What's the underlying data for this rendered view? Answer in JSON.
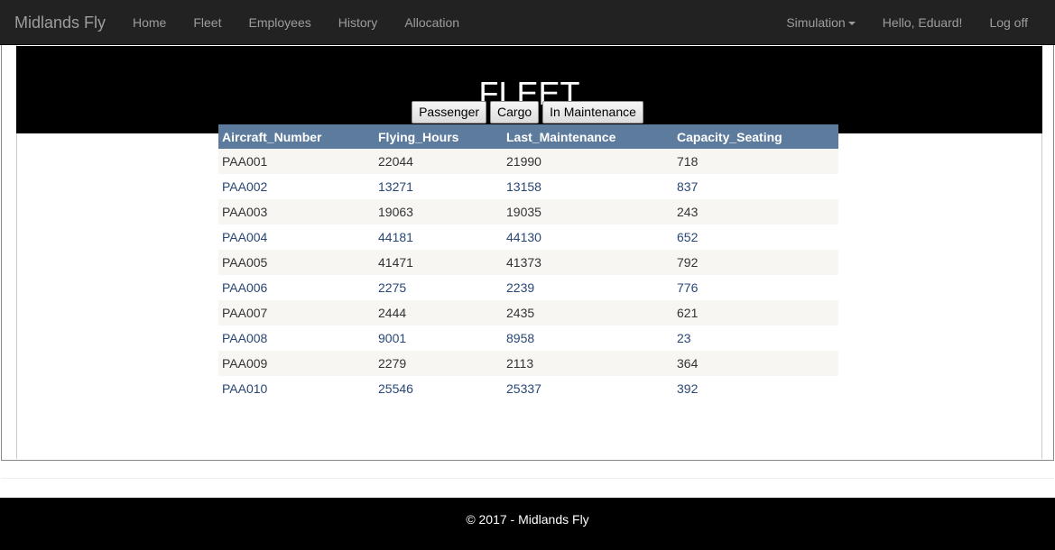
{
  "navbar": {
    "brand": "Midlands Fly",
    "left_items": [
      "Home",
      "Fleet",
      "Employees",
      "History",
      "Allocation"
    ],
    "simulation_label": "Simulation",
    "greeting": "Hello, Eduard!",
    "logoff_label": "Log off"
  },
  "page": {
    "title": "FLEET"
  },
  "filters": {
    "passenger": "Passenger",
    "cargo": "Cargo",
    "maintenance": "In Maintenance"
  },
  "table": {
    "headers": [
      "Aircraft_Number",
      "Flying_Hours",
      "Last_Maintenance",
      "Capacity_Seating"
    ],
    "rows": [
      [
        "PAA001",
        "22044",
        "21990",
        "718"
      ],
      [
        "PAA002",
        "13271",
        "13158",
        "837"
      ],
      [
        "PAA003",
        "19063",
        "19035",
        "243"
      ],
      [
        "PAA004",
        "44181",
        "44130",
        "652"
      ],
      [
        "PAA005",
        "41471",
        "41373",
        "792"
      ],
      [
        "PAA006",
        "2275",
        "2239",
        "776"
      ],
      [
        "PAA007",
        "2444",
        "2435",
        "621"
      ],
      [
        "PAA008",
        "9001",
        "8958",
        "23"
      ],
      [
        "PAA009",
        "2279",
        "2113",
        "364"
      ],
      [
        "PAA010",
        "25546",
        "25337",
        "392"
      ]
    ]
  },
  "footer": {
    "text": "© 2017 - Midlands Fly"
  },
  "colors": {
    "navbar_bg": "#222222",
    "nav_text": "#9d9d9d",
    "header_bg": "#5d7b9d",
    "alt_row_bg": "#f7f6f3",
    "link_row_text": "#284775",
    "jumbotron_bg": "#000000"
  },
  "icons": {
    "simulation_dropdown": "caret-down-icon"
  }
}
